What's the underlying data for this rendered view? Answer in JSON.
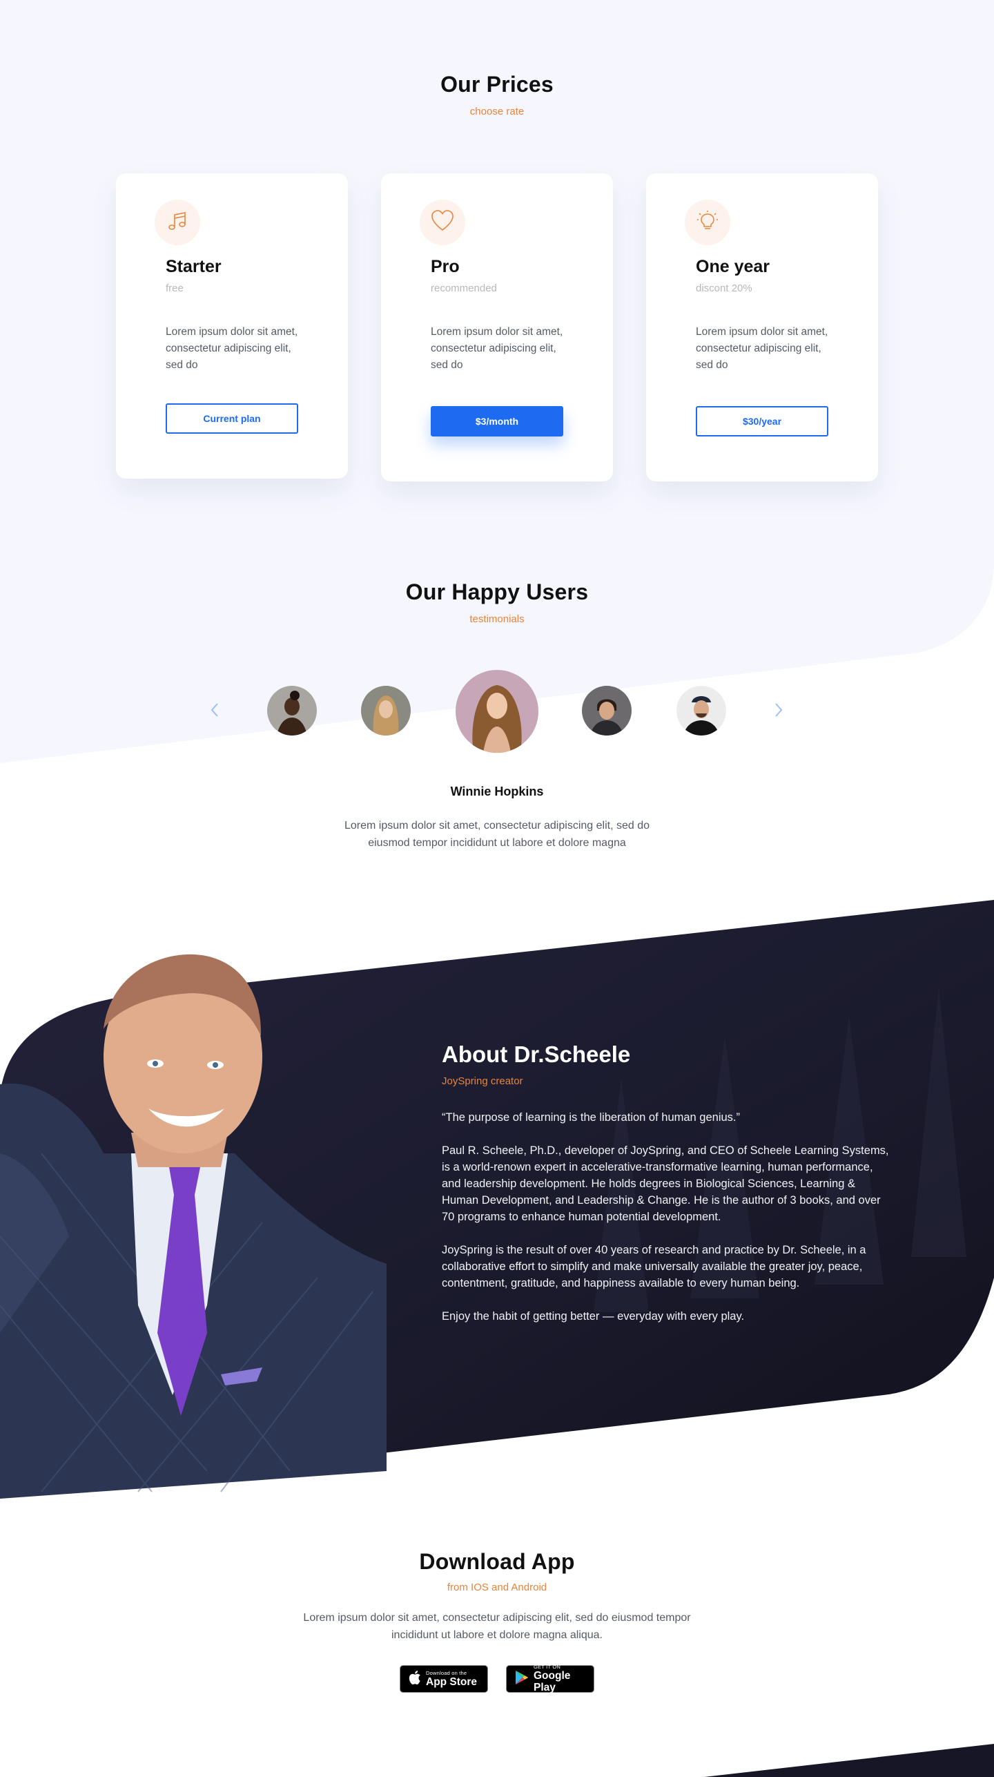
{
  "colors": {
    "accent_orange": "#e8843b",
    "brand_blue": "#1d6bf0",
    "light_bg": "#f6f7fe",
    "dark_bg": "#1b1a2b",
    "text_dark": "#111111",
    "text_gray": "#555a66"
  },
  "prices": {
    "title": "Our Prices",
    "subtitle": "choose rate",
    "plans": [
      {
        "icon": "music-note-icon",
        "name": "Starter",
        "sub": "free",
        "description": "Lorem ipsum dolor sit amet, consectetur adipiscing elit, sed do",
        "button": "Current plan"
      },
      {
        "icon": "heart-icon",
        "name": "Pro",
        "sub": "recommended",
        "description": "Lorem ipsum dolor sit amet, consectetur adipiscing elit, sed do",
        "button": "$3/month"
      },
      {
        "icon": "lightbulb-icon",
        "name": "One year",
        "sub": "discont 20%",
        "description": "Lorem ipsum dolor sit amet, consectetur adipiscing elit, sed do",
        "button": "$30/year"
      }
    ]
  },
  "testimonials": {
    "title": "Our Happy Users",
    "subtitle": "testimonials",
    "prev_icon": "chevron-left-icon",
    "next_icon": "chevron-right-icon",
    "active_name": "Winnie Hopkins",
    "active_text": "Lorem ipsum dolor sit amet, consectetur adipiscing elit, sed do eiusmod tempor incididunt ut labore et dolore magna"
  },
  "about": {
    "title": "About Dr.Scheele",
    "subtitle": "JoySpring creator",
    "paragraphs": [
      "“The purpose of learning is the liberation of human genius.”",
      "Paul R. Scheele, Ph.D., developer of JoySpring, and CEO of Scheele Learning Systems, is a world-renown expert in accelerative-transformative learning, human performance, and leadership development. He holds degrees in Biological Sciences, Learning & Human Development, and Leadership & Change. He is the author of 3 books, and over 70 programs to enhance human potential development.",
      "JoySpring is the result of over 40 years of research and practice by Dr. Scheele, in a collaborative effort to simplify and make universally available the greater joy, peace, contentment, gratitude, and happiness available to every human being.",
      "Enjoy the habit of getting better — everyday with every play."
    ]
  },
  "download": {
    "title": "Download App",
    "subtitle": "from IOS and Android",
    "text": "Lorem ipsum dolor sit amet, consectetur adipiscing elit, sed do eiusmod tempor incididunt ut labore et dolore magna aliqua.",
    "appstore": {
      "small": "Download on the",
      "big": "App Store",
      "icon": "apple-icon"
    },
    "googleplay": {
      "small": "GET IT ON",
      "big": "Google Play",
      "icon": "google-play-icon"
    }
  }
}
